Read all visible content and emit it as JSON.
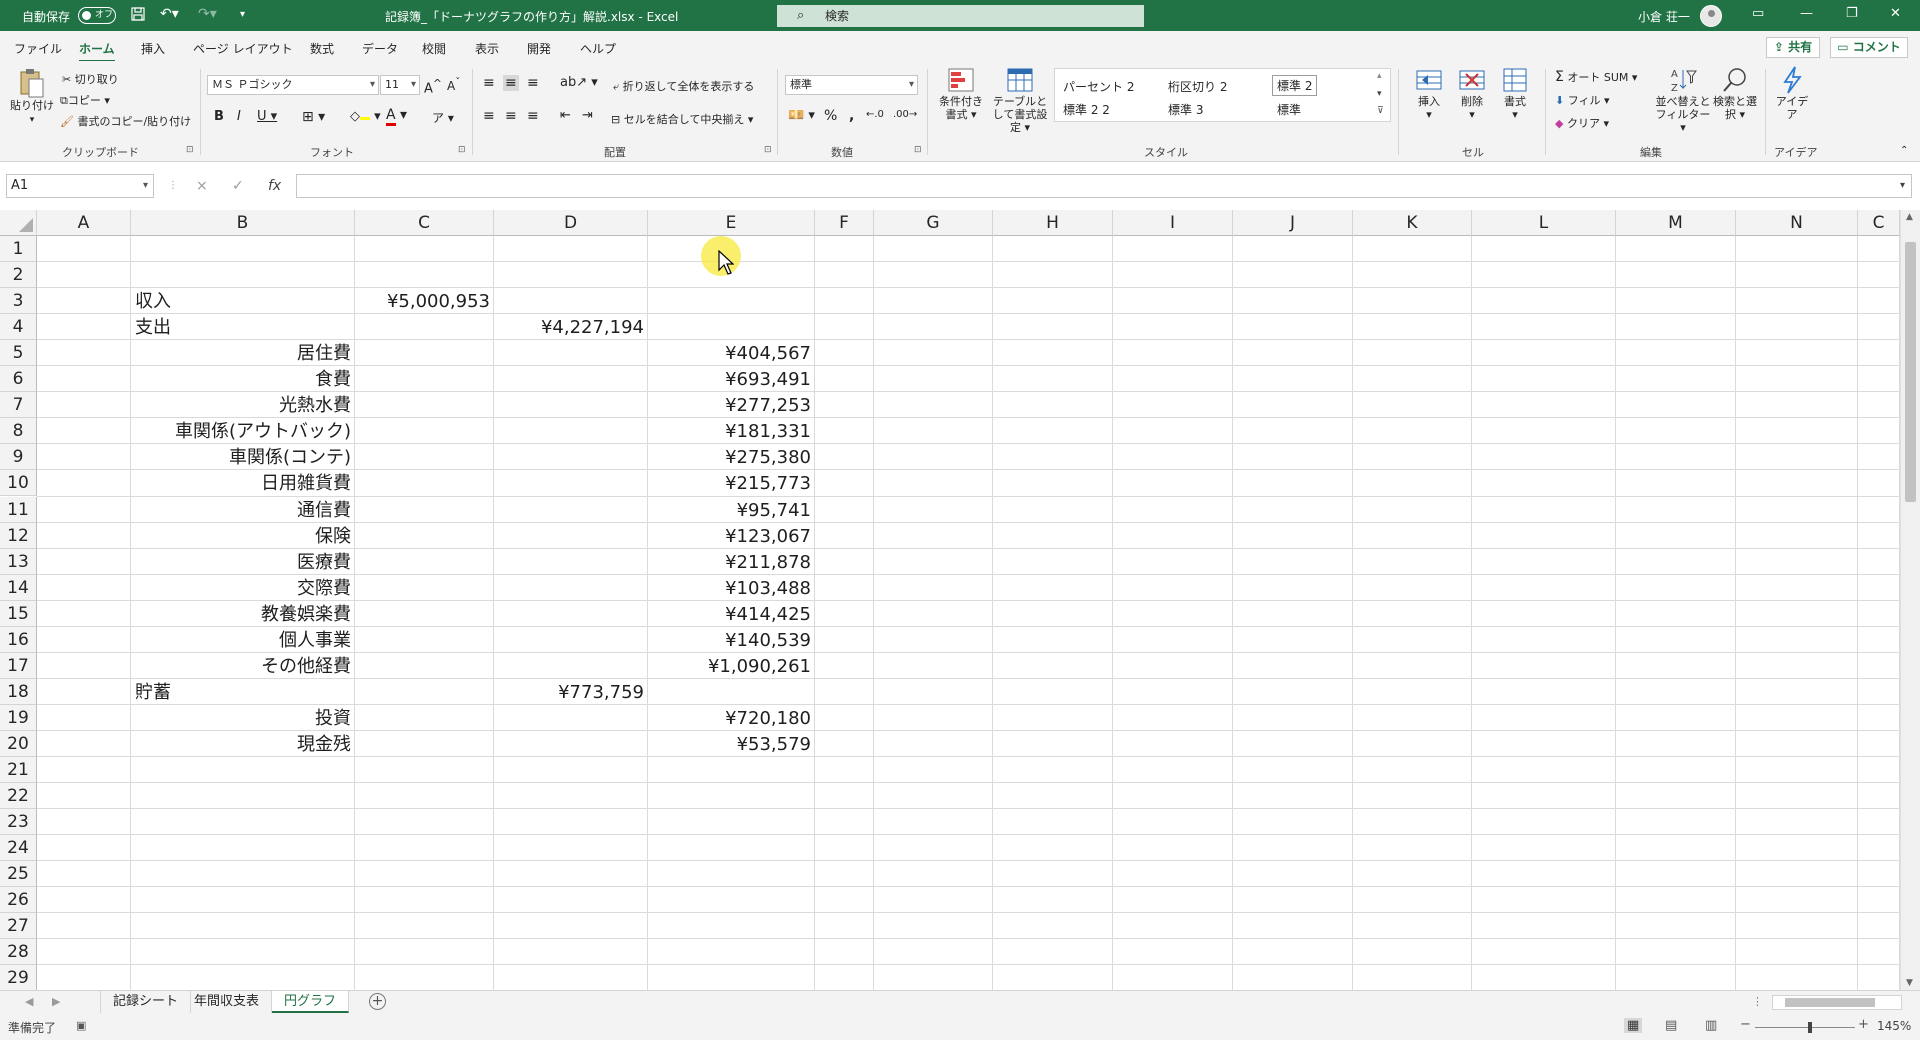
{
  "titlebar": {
    "autosave_label": "自動保存",
    "autosave_state": "オフ",
    "doc_title": "記録簿_「ドーナツグラフの作り方」解説.xlsx  -  Excel",
    "search_placeholder": "検索",
    "user_name": "小倉 荘一"
  },
  "ribbon_tabs": [
    "ファイル",
    "ホーム",
    "挿入",
    "ページ レイアウト",
    "数式",
    "データ",
    "校閲",
    "表示",
    "開発",
    "ヘルプ"
  ],
  "active_tab": "ホーム",
  "share_label": "共有",
  "comment_label": "コメント",
  "ribbon": {
    "clipboard": {
      "paste": "貼り付け",
      "cut": "切り取り",
      "copy": "コピー",
      "format_painter": "書式のコピー/貼り付け",
      "label": "クリップボード"
    },
    "font": {
      "name": "ＭＳ Ｐゴシック",
      "size": "11",
      "label": "フォント"
    },
    "alignment": {
      "wrap": "折り返して全体を表示する",
      "merge": "セルを結合して中央揃え",
      "label": "配置"
    },
    "number": {
      "format": "標準",
      "label": "数値"
    },
    "styles": {
      "conditional": "条件付き書式",
      "table": "テーブルとして書式設定",
      "items": [
        "パーセント 2",
        "桁区切り 2",
        "標準 2",
        "標準 2 2",
        "標準 3",
        "標準"
      ],
      "label": "スタイル"
    },
    "cells": {
      "insert": "挿入",
      "delete": "削除",
      "format": "書式",
      "label": "セル"
    },
    "editing": {
      "autosum": "オート SUM",
      "fill": "フィル",
      "clear": "クリア",
      "sort": "並べ替えとフィルター",
      "find": "検索と選択",
      "label": "編集"
    },
    "ideas": {
      "button": "アイデア",
      "label": "アイデア"
    }
  },
  "name_box": "A1",
  "formula_icons": [
    "×",
    "✓",
    "fx"
  ],
  "columns": [
    "A",
    "B",
    "C",
    "D",
    "E",
    "F",
    "G",
    "H",
    "I",
    "J",
    "K",
    "L",
    "M",
    "N",
    "C"
  ],
  "rows": [
    "1",
    "2",
    "3",
    "4",
    "5",
    "6",
    "7",
    "8",
    "9",
    "10",
    "11",
    "12",
    "13",
    "14",
    "15",
    "16",
    "17",
    "18",
    "19",
    "20",
    "21",
    "22",
    "23",
    "24",
    "25",
    "26",
    "27",
    "28",
    "29"
  ],
  "cells": [
    {
      "row": 3,
      "col": "B",
      "value": "収入",
      "align": "left"
    },
    {
      "row": 3,
      "col": "C",
      "value": "¥5,000,953",
      "align": "right"
    },
    {
      "row": 4,
      "col": "B",
      "value": "支出",
      "align": "left"
    },
    {
      "row": 4,
      "col": "D",
      "value": "¥4,227,194",
      "align": "right"
    },
    {
      "row": 5,
      "col": "B",
      "value": "居住費",
      "align": "right"
    },
    {
      "row": 5,
      "col": "E",
      "value": "¥404,567",
      "align": "right"
    },
    {
      "row": 6,
      "col": "B",
      "value": "食費",
      "align": "right"
    },
    {
      "row": 6,
      "col": "E",
      "value": "¥693,491",
      "align": "right"
    },
    {
      "row": 7,
      "col": "B",
      "value": "光熱水費",
      "align": "right"
    },
    {
      "row": 7,
      "col": "E",
      "value": "¥277,253",
      "align": "right"
    },
    {
      "row": 8,
      "col": "B",
      "value": "車関係(アウトバック)",
      "align": "right"
    },
    {
      "row": 8,
      "col": "E",
      "value": "¥181,331",
      "align": "right"
    },
    {
      "row": 9,
      "col": "B",
      "value": "車関係(コンテ)",
      "align": "right"
    },
    {
      "row": 9,
      "col": "E",
      "value": "¥275,380",
      "align": "right"
    },
    {
      "row": 10,
      "col": "B",
      "value": "日用雑貨費",
      "align": "right"
    },
    {
      "row": 10,
      "col": "E",
      "value": "¥215,773",
      "align": "right"
    },
    {
      "row": 11,
      "col": "B",
      "value": "通信費",
      "align": "right"
    },
    {
      "row": 11,
      "col": "E",
      "value": "¥95,741",
      "align": "right"
    },
    {
      "row": 12,
      "col": "B",
      "value": "保険",
      "align": "right"
    },
    {
      "row": 12,
      "col": "E",
      "value": "¥123,067",
      "align": "right"
    },
    {
      "row": 13,
      "col": "B",
      "value": "医療費",
      "align": "right"
    },
    {
      "row": 13,
      "col": "E",
      "value": "¥211,878",
      "align": "right"
    },
    {
      "row": 14,
      "col": "B",
      "value": "交際費",
      "align": "right"
    },
    {
      "row": 14,
      "col": "E",
      "value": "¥103,488",
      "align": "right"
    },
    {
      "row": 15,
      "col": "B",
      "value": "教養娯楽費",
      "align": "right"
    },
    {
      "row": 15,
      "col": "E",
      "value": "¥414,425",
      "align": "right"
    },
    {
      "row": 16,
      "col": "B",
      "value": "個人事業",
      "align": "right"
    },
    {
      "row": 16,
      "col": "E",
      "value": "¥140,539",
      "align": "right"
    },
    {
      "row": 17,
      "col": "B",
      "value": "その他経費",
      "align": "right"
    },
    {
      "row": 17,
      "col": "E",
      "value": "¥1,090,261",
      "align": "right"
    },
    {
      "row": 18,
      "col": "B",
      "value": "貯蓄",
      "align": "left"
    },
    {
      "row": 18,
      "col": "D",
      "value": "¥773,759",
      "align": "right"
    },
    {
      "row": 19,
      "col": "B",
      "value": "投資",
      "align": "right"
    },
    {
      "row": 19,
      "col": "E",
      "value": "¥720,180",
      "align": "right"
    },
    {
      "row": 20,
      "col": "B",
      "value": "現金残",
      "align": "right"
    },
    {
      "row": 20,
      "col": "E",
      "value": "¥53,579",
      "align": "right"
    }
  ],
  "sheet_tabs": [
    "記録シート",
    "年間収支表",
    "円グラフ"
  ],
  "active_sheet": "円グラフ",
  "status": {
    "ready": "準備完了",
    "zoom": "145%"
  },
  "colors": {
    "accent": "#217346",
    "cursor_highlight": "#f8e83c"
  }
}
